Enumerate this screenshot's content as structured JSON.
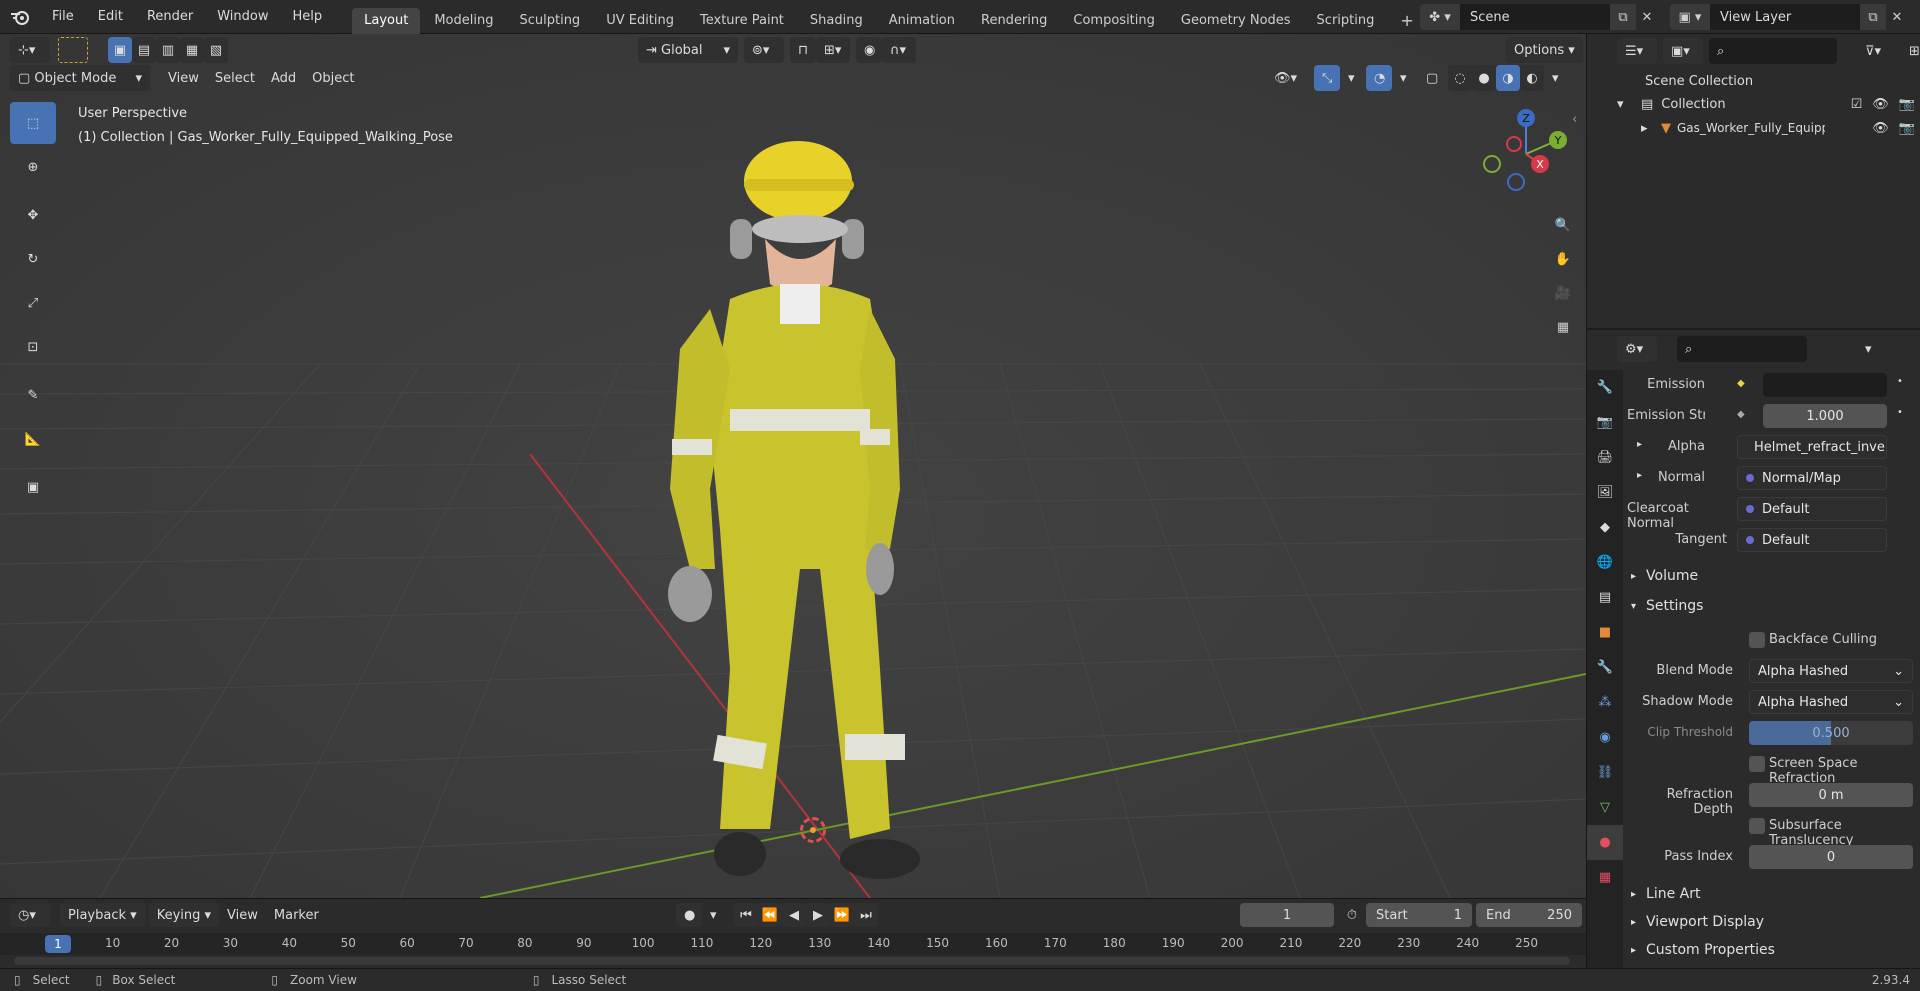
{
  "menu": {
    "items": [
      "File",
      "Edit",
      "Render",
      "Window",
      "Help"
    ]
  },
  "workspaces": [
    "Layout",
    "Modeling",
    "Sculpting",
    "UV Editing",
    "Texture Paint",
    "Shading",
    "Animation",
    "Rendering",
    "Compositing",
    "Geometry Nodes",
    "Scripting"
  ],
  "scene": {
    "name": "Scene",
    "view_layer": "View Layer"
  },
  "viewport": {
    "mode": "Object Mode",
    "menus": [
      "View",
      "Select",
      "Add",
      "Object"
    ],
    "orientation": "Global",
    "options_label": "Options",
    "overlay_title": "User Perspective",
    "overlay_subtitle": "(1) Collection | Gas_Worker_Fully_Equipped_Walking_Pose",
    "gizmo": {
      "z": "Z",
      "y": "Y",
      "x": "X"
    }
  },
  "outliner": {
    "root": "Scene Collection",
    "collection": "Collection",
    "object": "Gas_Worker_Fully_Equipp"
  },
  "properties": {
    "emission_label": "Emission",
    "emission_strength_label": "Emission Strengt",
    "emission_strength_value": "1.000",
    "alpha_label": "Alpha",
    "alpha_value": "Helmet_refract_inve...",
    "normal_label": "Normal",
    "normal_value": "Normal/Map",
    "clearcoat_label": "Clearcoat Normal",
    "clearcoat_value": "Default",
    "tangent_label": "Tangent",
    "tangent_value": "Default",
    "volume_section": "Volume",
    "settings_section": "Settings",
    "backface_label": "Backface Culling",
    "blend_mode_label": "Blend Mode",
    "blend_mode_value": "Alpha Hashed",
    "shadow_mode_label": "Shadow Mode",
    "shadow_mode_value": "Alpha Hashed",
    "clip_label": "Clip Threshold",
    "clip_value": "0.500",
    "ssr_label": "Screen Space Refraction",
    "refraction_depth_label": "Refraction Depth",
    "refraction_depth_value": "0 m",
    "subsurface_label": "Subsurface Translucency",
    "pass_index_label": "Pass Index",
    "pass_index_value": "0",
    "line_art_section": "Line Art",
    "viewport_display_section": "Viewport Display",
    "custom_props_section": "Custom Properties"
  },
  "timeline": {
    "menus": [
      "Playback",
      "Keying",
      "View",
      "Marker"
    ],
    "current_frame": "1",
    "start_label": "Start",
    "start_value": "1",
    "end_label": "End",
    "end_value": "250",
    "ruler": [
      "10",
      "20",
      "30",
      "40",
      "50",
      "60",
      "70",
      "80",
      "90",
      "100",
      "110",
      "120",
      "130",
      "140",
      "150",
      "160",
      "170",
      "180",
      "190",
      "200",
      "210",
      "220",
      "230",
      "240",
      "250"
    ],
    "playhead": "1"
  },
  "status": {
    "select": "Select",
    "box_select": "Box Select",
    "zoom_view": "Zoom View",
    "lasso_select": "Lasso Select",
    "version": "2.93.4"
  }
}
